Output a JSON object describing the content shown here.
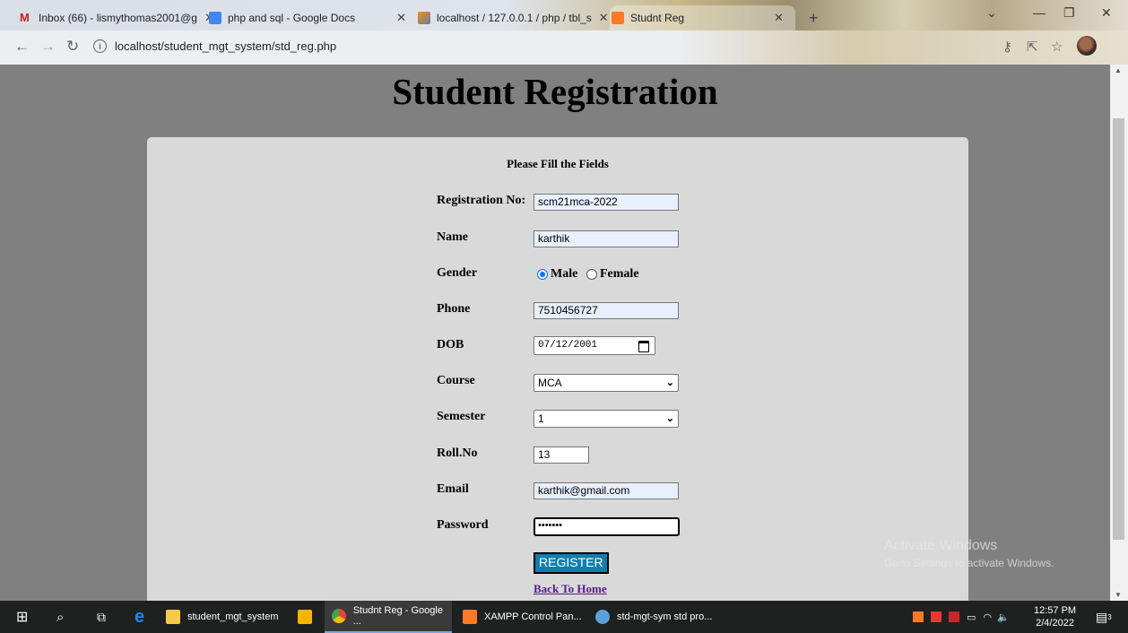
{
  "browser": {
    "tabs": [
      {
        "title": "Inbox (66) - lismythomas2001@g",
        "icon": "gmail-icon",
        "color": "#c5221f"
      },
      {
        "title": "php and sql - Google Docs",
        "icon": "docs-icon",
        "color": "#4285f4"
      },
      {
        "title": "localhost / 127.0.0.1 / php / tbl_s",
        "icon": "phpmyadmin-icon",
        "color": "#f29111"
      },
      {
        "title": "Studnt Reg",
        "icon": "xampp-icon",
        "color": "#fb7a24"
      }
    ],
    "url_path": "localhost/student_mgt_system/std_reg.php"
  },
  "page": {
    "title": "Student Registration",
    "subtitle": "Please Fill the Fields",
    "labels": {
      "regno": "Registration No:",
      "name": "Name",
      "gender": "Gender",
      "phone": "Phone",
      "dob": "DOB",
      "course": "Course",
      "semester": "Semester",
      "rollno": "Roll.No",
      "email": "Email",
      "password": "Password"
    },
    "values": {
      "regno": "scm21mca-2022",
      "name": "karthik",
      "gender_male": "Male",
      "gender_female": "Female",
      "gender_selected": "Male",
      "phone": "7510456727",
      "dob": "07/12/2001",
      "course": "MCA",
      "semester": "1",
      "rollno": "13",
      "email": "karthik@gmail.com",
      "password": "•••••••"
    },
    "register_label": "REGISTER",
    "back_link": "Back To Home",
    "watermark_title": "Activate Windows",
    "watermark_sub": "Go to Settings to activate Windows."
  },
  "taskbar": {
    "items": [
      {
        "label": "student_mgt_system",
        "icon": "folder-icon",
        "color": "#f7c948"
      },
      {
        "label": "",
        "icon": "store-icon",
        "color": "#f5b400"
      },
      {
        "label": "Studnt Reg - Google ...",
        "icon": "chrome-icon",
        "color": "#34a853"
      },
      {
        "label": "XAMPP Control Pan...",
        "icon": "xampp-icon",
        "color": "#fb7a24"
      },
      {
        "label": "std-mgt-sym std pro...",
        "icon": "paint-icon",
        "color": "#5aa0d8"
      }
    ],
    "time": "12:57 PM",
    "date": "2/4/2022",
    "notification_count": "3"
  }
}
